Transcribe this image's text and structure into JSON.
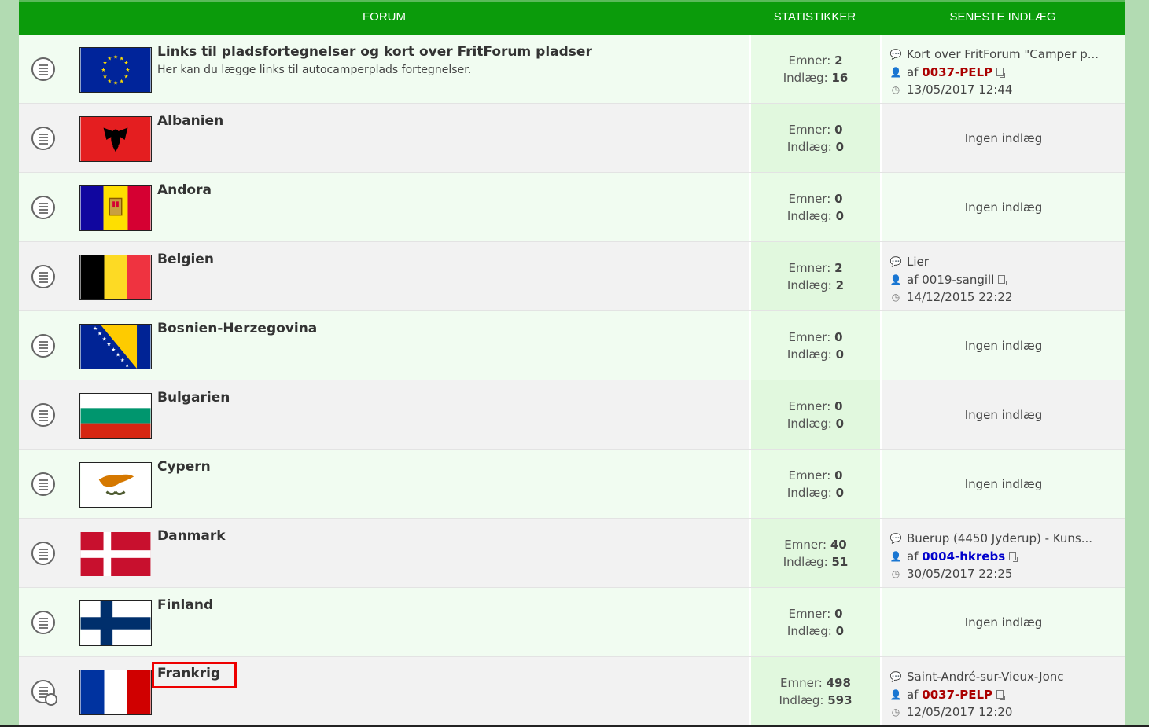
{
  "header": {
    "forum": "FORUM",
    "stats": "STATISTIKKER",
    "last": "SENESTE INDLÆG"
  },
  "labels": {
    "topics": "Emner:",
    "posts": "Indlæg:",
    "none": "Ingen indlæg",
    "by": "af"
  },
  "rows": [
    {
      "title": "Links til pladsfortegnelser og kort over FritForum pladser",
      "desc": "Her kan du lægge links til autocamperplads fortegnelser.",
      "flag": "eu-flag",
      "topics": "2",
      "posts": "16",
      "last_title": "Kort over FritForum \"Camper p...",
      "last_user": "0037-PELP",
      "last_date": "13/05/2017 12:44"
    },
    {
      "title": "Albanien",
      "flag": "albania-flag",
      "topics": "0",
      "posts": "0"
    },
    {
      "title": "Andora",
      "flag": "andorra-flag",
      "topics": "0",
      "posts": "0"
    },
    {
      "title": "Belgien",
      "flag": "belgium-flag",
      "topics": "2",
      "posts": "2",
      "last_title": "Lier",
      "last_user": "0019-sangill",
      "last_date": "14/12/2015 22:22"
    },
    {
      "title": "Bosnien-Herzegovina",
      "flag": "bosnia-flag",
      "topics": "0",
      "posts": "0"
    },
    {
      "title": "Bulgarien",
      "flag": "bulgaria-flag",
      "topics": "0",
      "posts": "0"
    },
    {
      "title": "Cypern",
      "flag": "cyprus-flag",
      "topics": "0",
      "posts": "0"
    },
    {
      "title": "Danmark",
      "flag": "denmark-flag",
      "topics": "40",
      "posts": "51",
      "last_title": "Buerup (4450 Jyderup) - Kuns...",
      "last_user": "0004-hkrebs",
      "last_date": "30/05/2017 22:25"
    },
    {
      "title": "Finland",
      "flag": "finland-flag",
      "topics": "0",
      "posts": "0"
    },
    {
      "title": "Frankrig",
      "flag": "france-flag",
      "topics": "498",
      "posts": "593",
      "last_title": "Saint-André-sur-Vieux-Jonc",
      "last_user": "0037-PELP",
      "last_date": "12/05/2017 12:20"
    }
  ],
  "colors": {
    "header_green": "#0b9b0b",
    "user_red": "#aa0000",
    "user_blue": "#0000cc",
    "highlight": "#e00000"
  }
}
